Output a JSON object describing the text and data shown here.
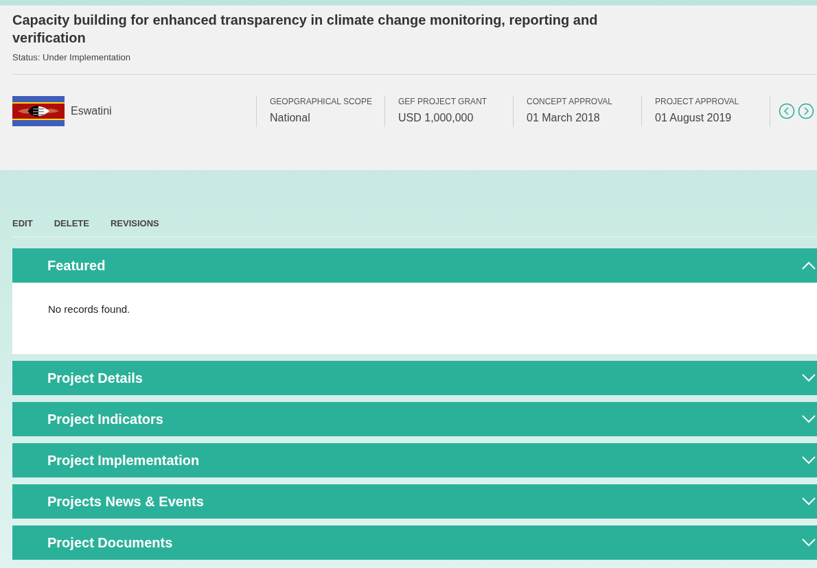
{
  "title": "Capacity building for enhanced transparency in climate change monitoring, reporting and verification",
  "status": "Status: Under Implementation",
  "country": "Eswatini",
  "facts": [
    {
      "label": "GEOPGRAPHICAL SCOPE",
      "value": "National"
    },
    {
      "label": "GEF PROJECT GRANT",
      "value": "USD 1,000,000"
    },
    {
      "label": "CONCEPT APPROVAL",
      "value": "01 March 2018"
    },
    {
      "label": "PROJECT APPROVAL",
      "value": "01 August 2019"
    }
  ],
  "actions": [
    "EDIT",
    "DELETE",
    "REVISIONS"
  ],
  "sections": [
    {
      "title": "Featured",
      "expanded": true,
      "body": "No records found."
    },
    {
      "title": "Project Details",
      "expanded": false
    },
    {
      "title": "Project Indicators",
      "expanded": false
    },
    {
      "title": "Project Implementation",
      "expanded": false
    },
    {
      "title": "Projects News & Events",
      "expanded": false
    },
    {
      "title": "Project Documents",
      "expanded": false
    }
  ]
}
